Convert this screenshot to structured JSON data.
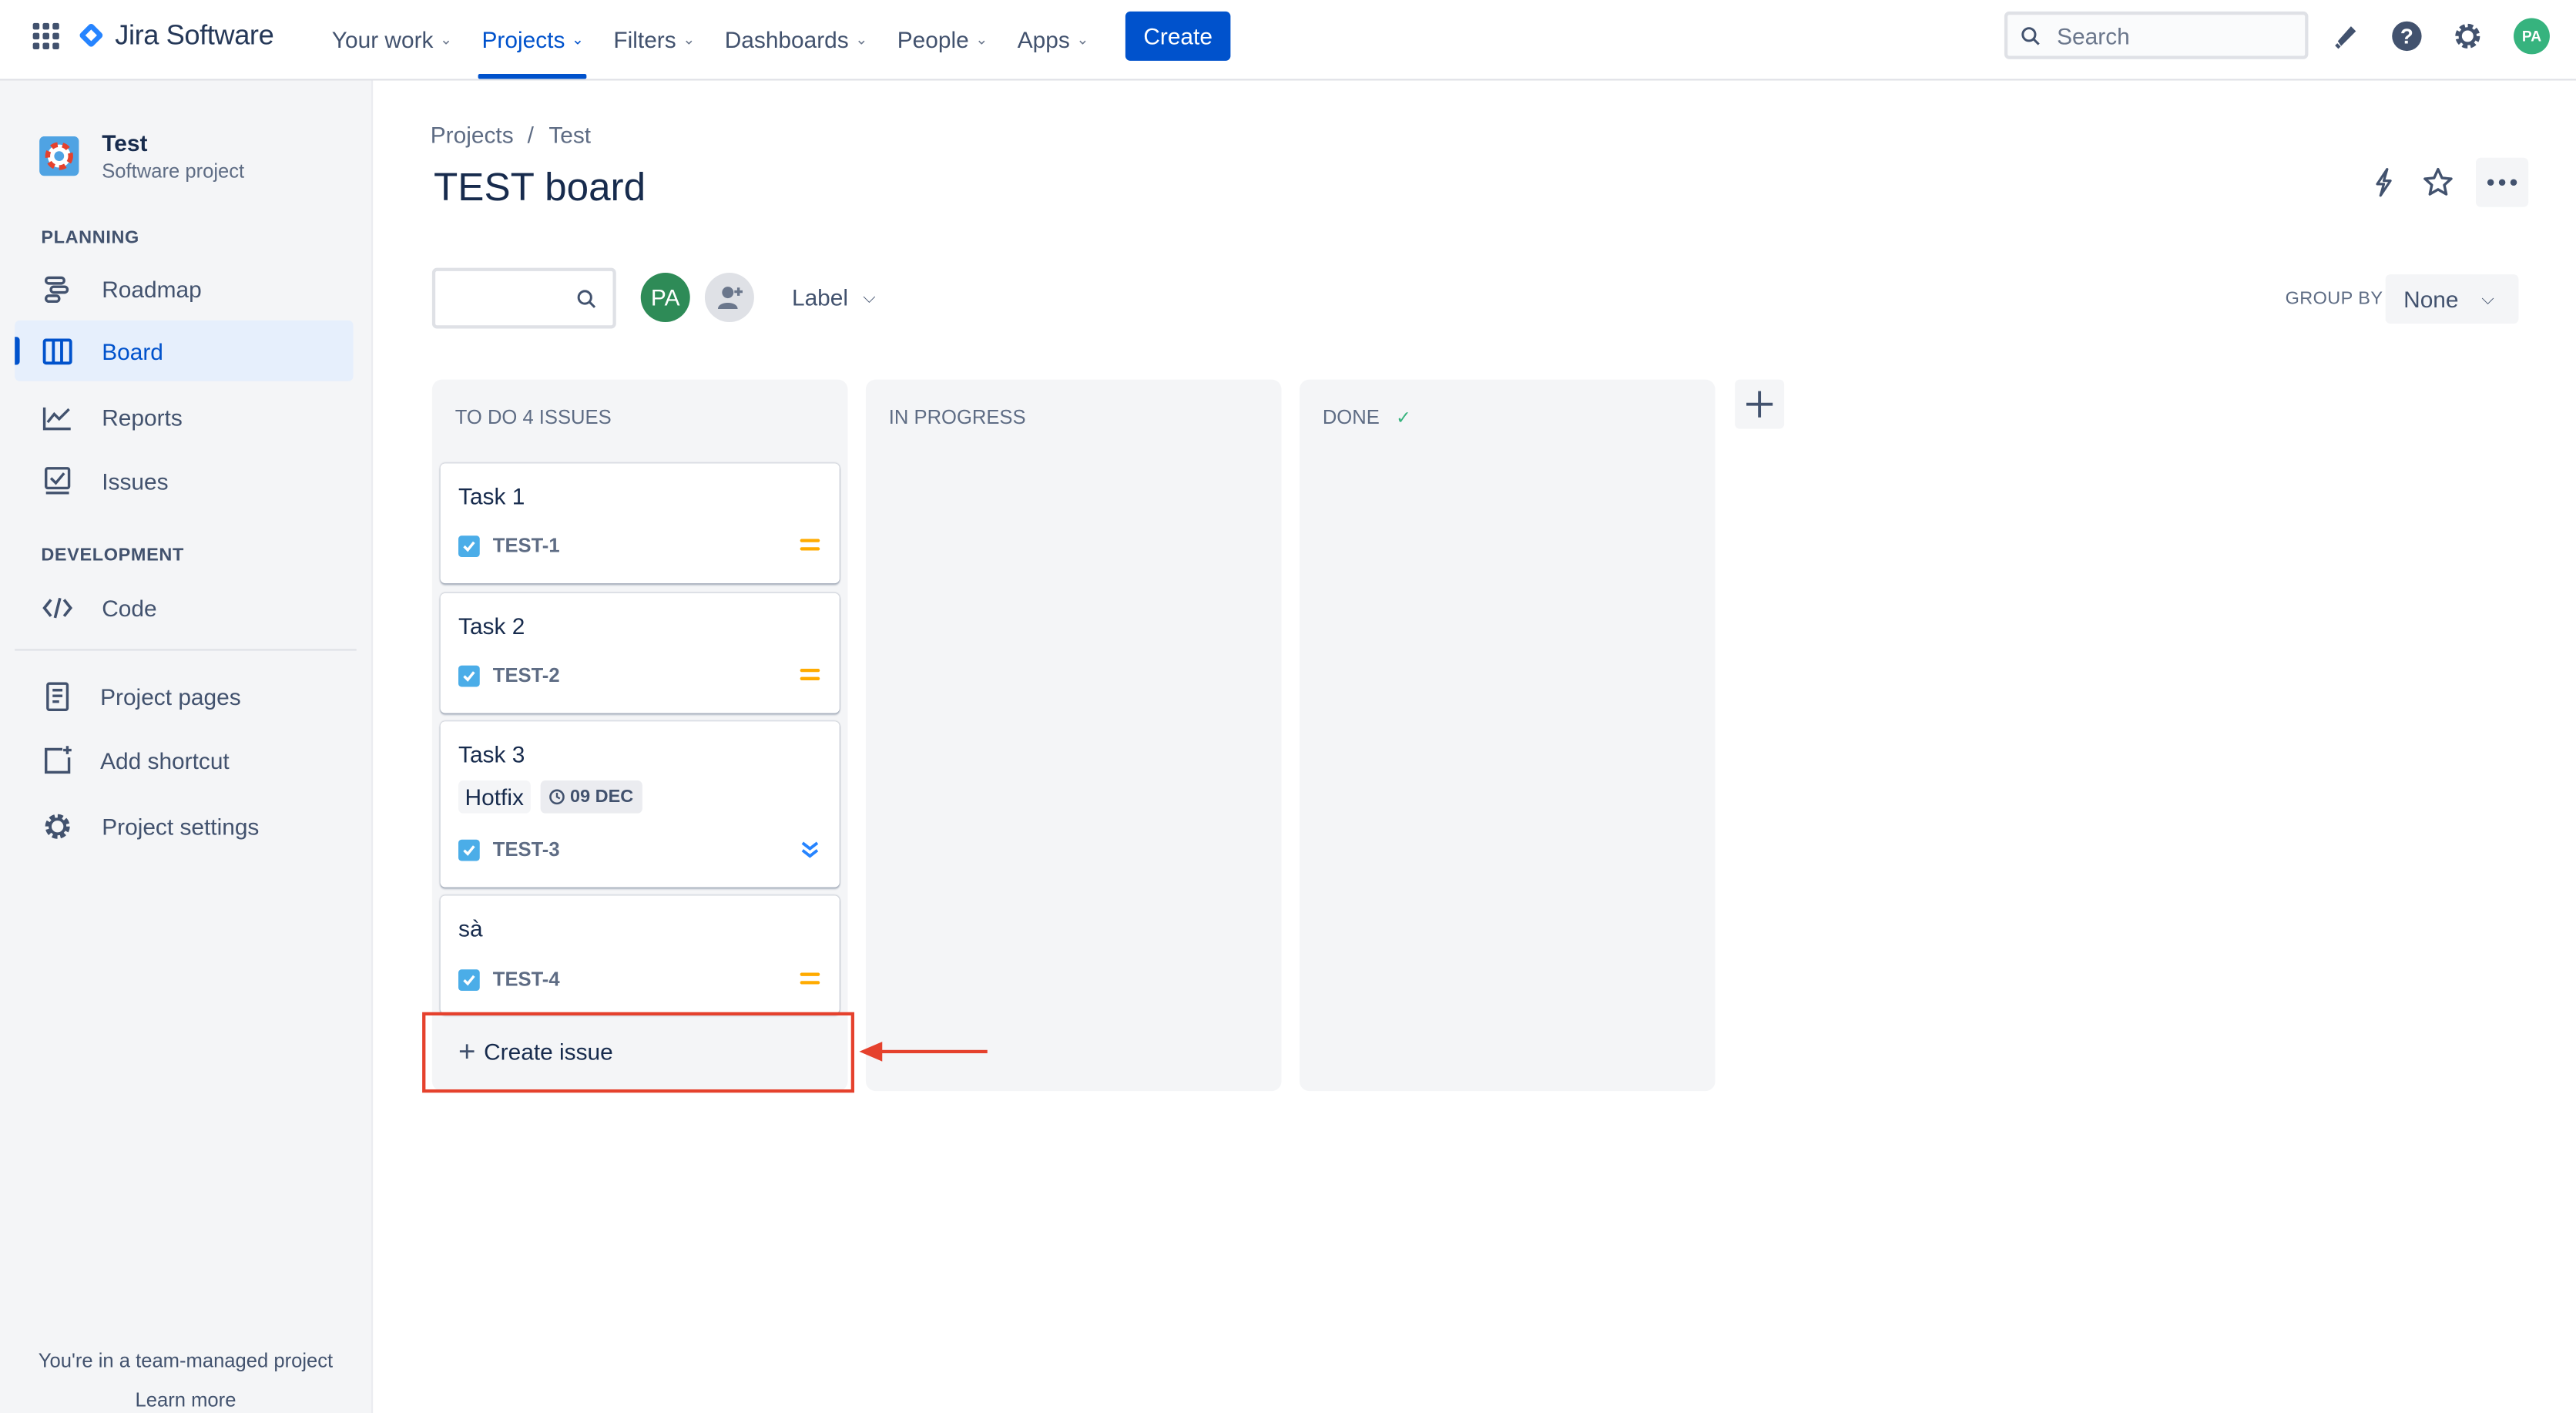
{
  "topnav": {
    "product": "Jira Software",
    "items": [
      {
        "label": "Your work",
        "active": false
      },
      {
        "label": "Projects",
        "active": true
      },
      {
        "label": "Filters",
        "active": false
      },
      {
        "label": "Dashboards",
        "active": false
      },
      {
        "label": "People",
        "active": false
      },
      {
        "label": "Apps",
        "active": false
      }
    ],
    "create_label": "Create",
    "search_placeholder": "Search",
    "user_initials": "PA"
  },
  "sidebar": {
    "project_name": "Test",
    "project_type": "Software project",
    "planning_heading": "PLANNING",
    "planning_items": [
      {
        "label": "Roadmap",
        "icon": "roadmap-icon"
      },
      {
        "label": "Board",
        "icon": "board-icon",
        "active": true
      },
      {
        "label": "Reports",
        "icon": "reports-icon"
      },
      {
        "label": "Issues",
        "icon": "issues-icon"
      }
    ],
    "development_heading": "DEVELOPMENT",
    "development_items": [
      {
        "label": "Code",
        "icon": "code-icon"
      }
    ],
    "other_items": [
      {
        "label": "Project pages",
        "icon": "page-icon"
      },
      {
        "label": "Add shortcut",
        "icon": "add-shortcut-icon"
      },
      {
        "label": "Project settings",
        "icon": "gear-icon"
      }
    ],
    "footer_text": "You're in a team-managed project",
    "footer_link": "Learn more"
  },
  "main": {
    "breadcrumbs": [
      "Projects",
      "/",
      "Test"
    ],
    "title": "TEST board",
    "filter_avatar": "PA",
    "label_filter": "Label",
    "group_by_label": "GROUP BY",
    "group_by_value": "None",
    "columns": [
      {
        "name": "TO DO 4 ISSUES"
      },
      {
        "name": "IN PROGRESS"
      },
      {
        "name": "DONE",
        "check": "✓"
      }
    ],
    "cards": [
      {
        "title": "Task 1",
        "key": "TEST-1",
        "priority": "medium"
      },
      {
        "title": "Task 2",
        "key": "TEST-2",
        "priority": "medium"
      },
      {
        "title": "Task 3",
        "key": "TEST-3",
        "priority": "lowest",
        "label": "Hotfix",
        "due": "09 DEC"
      },
      {
        "title": "sà",
        "key": "TEST-4",
        "priority": "medium"
      }
    ],
    "create_issue_label": "Create issue"
  },
  "colors": {
    "brand": "#0052cc",
    "annotation": "#e5412d",
    "avatar": "#2e8b57",
    "priority_medium": "#ffab00",
    "priority_lowest": "#2684ff"
  }
}
